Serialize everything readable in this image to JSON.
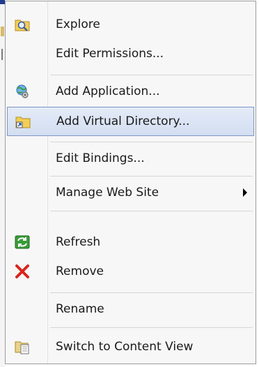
{
  "menu": {
    "items": [
      {
        "label": "Explore",
        "icon": "folder-search-icon"
      },
      {
        "label": "Edit Permissions..."
      },
      {
        "label": "Add Application...",
        "icon": "globe-gear-icon"
      },
      {
        "label": "Add Virtual Directory...",
        "icon": "folder-link-icon"
      },
      {
        "label": "Edit Bindings..."
      },
      {
        "label": "Manage Web Site",
        "icon": "submenu-arrow-icon"
      },
      {
        "label": "Refresh",
        "icon": "refresh-icon"
      },
      {
        "label": "Remove",
        "icon": "red-x-icon"
      },
      {
        "label": "Rename"
      },
      {
        "label": "Switch to Content View",
        "icon": "content-view-icon"
      }
    ],
    "highlighted_item": "Add Virtual Directory...",
    "colors": {
      "highlight": "#d3def1",
      "highlight_border": "#7d95c4",
      "remove_red": "#d9261c",
      "refresh_green": "#3a9b3a"
    }
  }
}
